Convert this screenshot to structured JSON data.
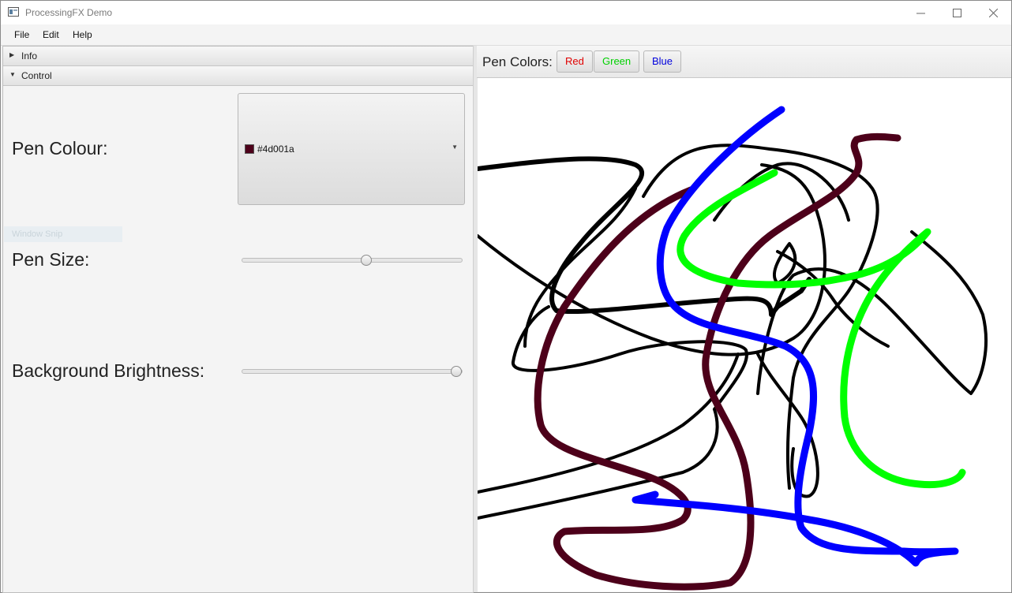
{
  "window": {
    "title": "ProcessingFX Demo"
  },
  "menu": {
    "items": [
      "File",
      "Edit",
      "Help"
    ]
  },
  "left_panel": {
    "sections": [
      {
        "label": "Info",
        "expanded": false
      },
      {
        "label": "Control",
        "expanded": true
      }
    ],
    "pen_colour": {
      "label": "Pen Colour:",
      "value": "#4d001a",
      "swatch": "#4d001a"
    },
    "pen_size": {
      "label": "Pen Size:",
      "value_fraction": 0.57
    },
    "background_brightness": {
      "label": "Background Brightness:",
      "value_fraction": 1.0
    },
    "overlay_text": "Window Snip"
  },
  "toolbar": {
    "label": "Pen Colors:",
    "buttons": [
      {
        "label": "Red",
        "color": "#e00000"
      },
      {
        "label": "Green",
        "color": "#00d000"
      },
      {
        "label": "Blue",
        "color": "#0000dd"
      }
    ]
  },
  "canvas": {
    "background": "#ffffff",
    "stroke_colors": [
      "#000000",
      "#4d001a",
      "#0000ff",
      "#00ff00"
    ]
  }
}
